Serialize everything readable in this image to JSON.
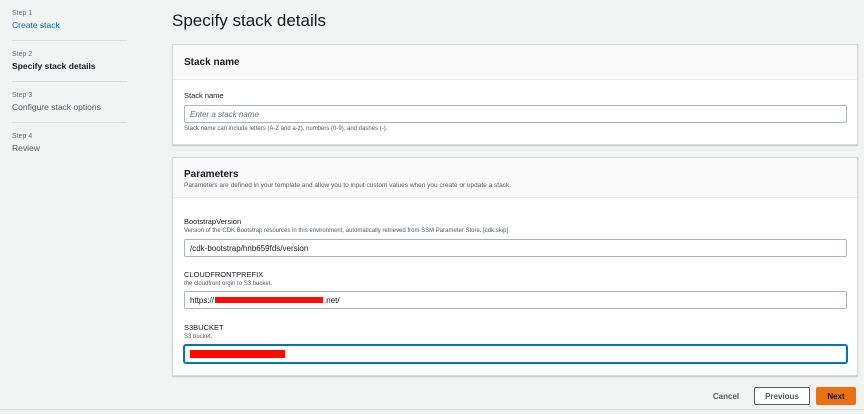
{
  "steps": [
    {
      "num": "Step 1",
      "title": "Create stack"
    },
    {
      "num": "Step 2",
      "title": "Specify stack details"
    },
    {
      "num": "Step 3",
      "title": "Configure stack options"
    },
    {
      "num": "Step 4",
      "title": "Review"
    }
  ],
  "page_title": "Specify stack details",
  "stack_name_panel": {
    "title": "Stack name",
    "field_label": "Stack name",
    "placeholder": "Enter a stack name",
    "value": "",
    "hint": "Stack name can include letters (A-Z and a-z), numbers (0-9), and dashes (-)."
  },
  "parameters_panel": {
    "title": "Parameters",
    "description": "Parameters are defined in your template and allow you to input custom values when you create or update a stack.",
    "fields": [
      {
        "label": "BootstrapVersion",
        "description": "Version of the CDK Bootstrap resources in this environment, automatically retrieved from SSM Parameter Store. [cdk:skip]",
        "value": "/cdk-bootstrap/hnb659fds/version"
      },
      {
        "label": "CLOUDFRONTPREFIX",
        "description": "the cloudfront orgin to S3 bucket.",
        "value_prefix": "https://",
        "value_suffix": ".net/"
      },
      {
        "label": "S3BUCKET",
        "description": "S3 bucket.",
        "value": ""
      }
    ]
  },
  "footer": {
    "cancel": "Cancel",
    "previous": "Previous",
    "next": "Next"
  },
  "colors": {
    "link": "#0073bb",
    "primary_button": "#ec7211",
    "redaction": "#ff0a00"
  }
}
